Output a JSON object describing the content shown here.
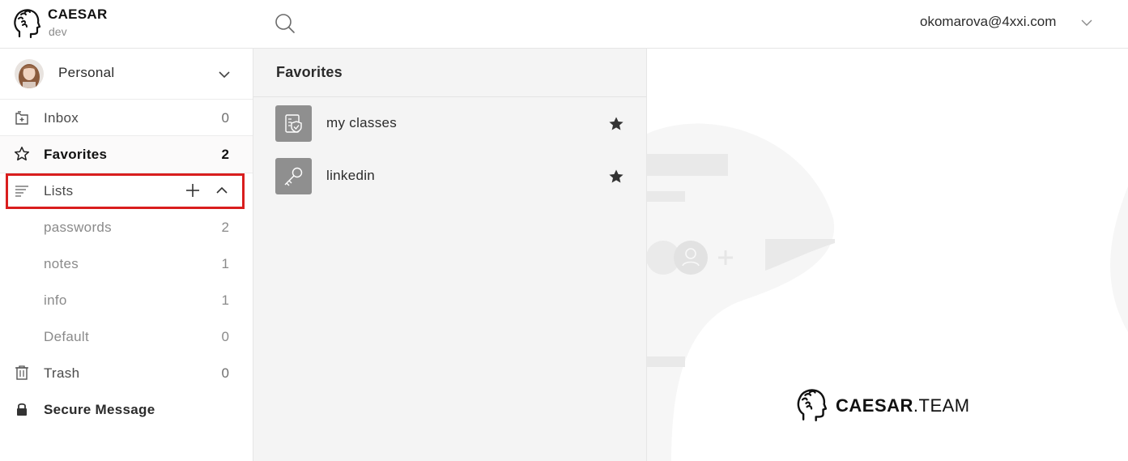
{
  "header": {
    "brand_name": "CAESAR",
    "brand_sub": "dev",
    "user_email": "okomarova@4xxi.com"
  },
  "sidebar": {
    "team_name": "Personal",
    "items": [
      {
        "label": "Inbox",
        "count": "0",
        "icon": "inbox-icon"
      },
      {
        "label": "Favorites",
        "count": "2",
        "icon": "star-outline-icon"
      },
      {
        "label": "Lists",
        "count": "",
        "icon": "lists-icon"
      },
      {
        "label": "passwords",
        "count": "2"
      },
      {
        "label": "notes",
        "count": "1"
      },
      {
        "label": "info",
        "count": "1"
      },
      {
        "label": "Default",
        "count": "0"
      },
      {
        "label": "Trash",
        "count": "0",
        "icon": "trash-icon"
      },
      {
        "label": "Secure Message",
        "count": "",
        "icon": "lock-icon"
      }
    ]
  },
  "list_panel": {
    "title": "Favorites",
    "items": [
      {
        "name": "my classes",
        "icon": "document-shield-icon",
        "favorite": true
      },
      {
        "name": "linkedin",
        "icon": "key-icon",
        "favorite": true
      }
    ]
  },
  "content": {
    "brand_bold": "CAESAR",
    "brand_light": ".TEAM"
  },
  "colors": {
    "accent_highlight": "#d91e1e",
    "panel_bg": "#f4f4f4",
    "item_icon_bg": "#8f8f8f"
  }
}
